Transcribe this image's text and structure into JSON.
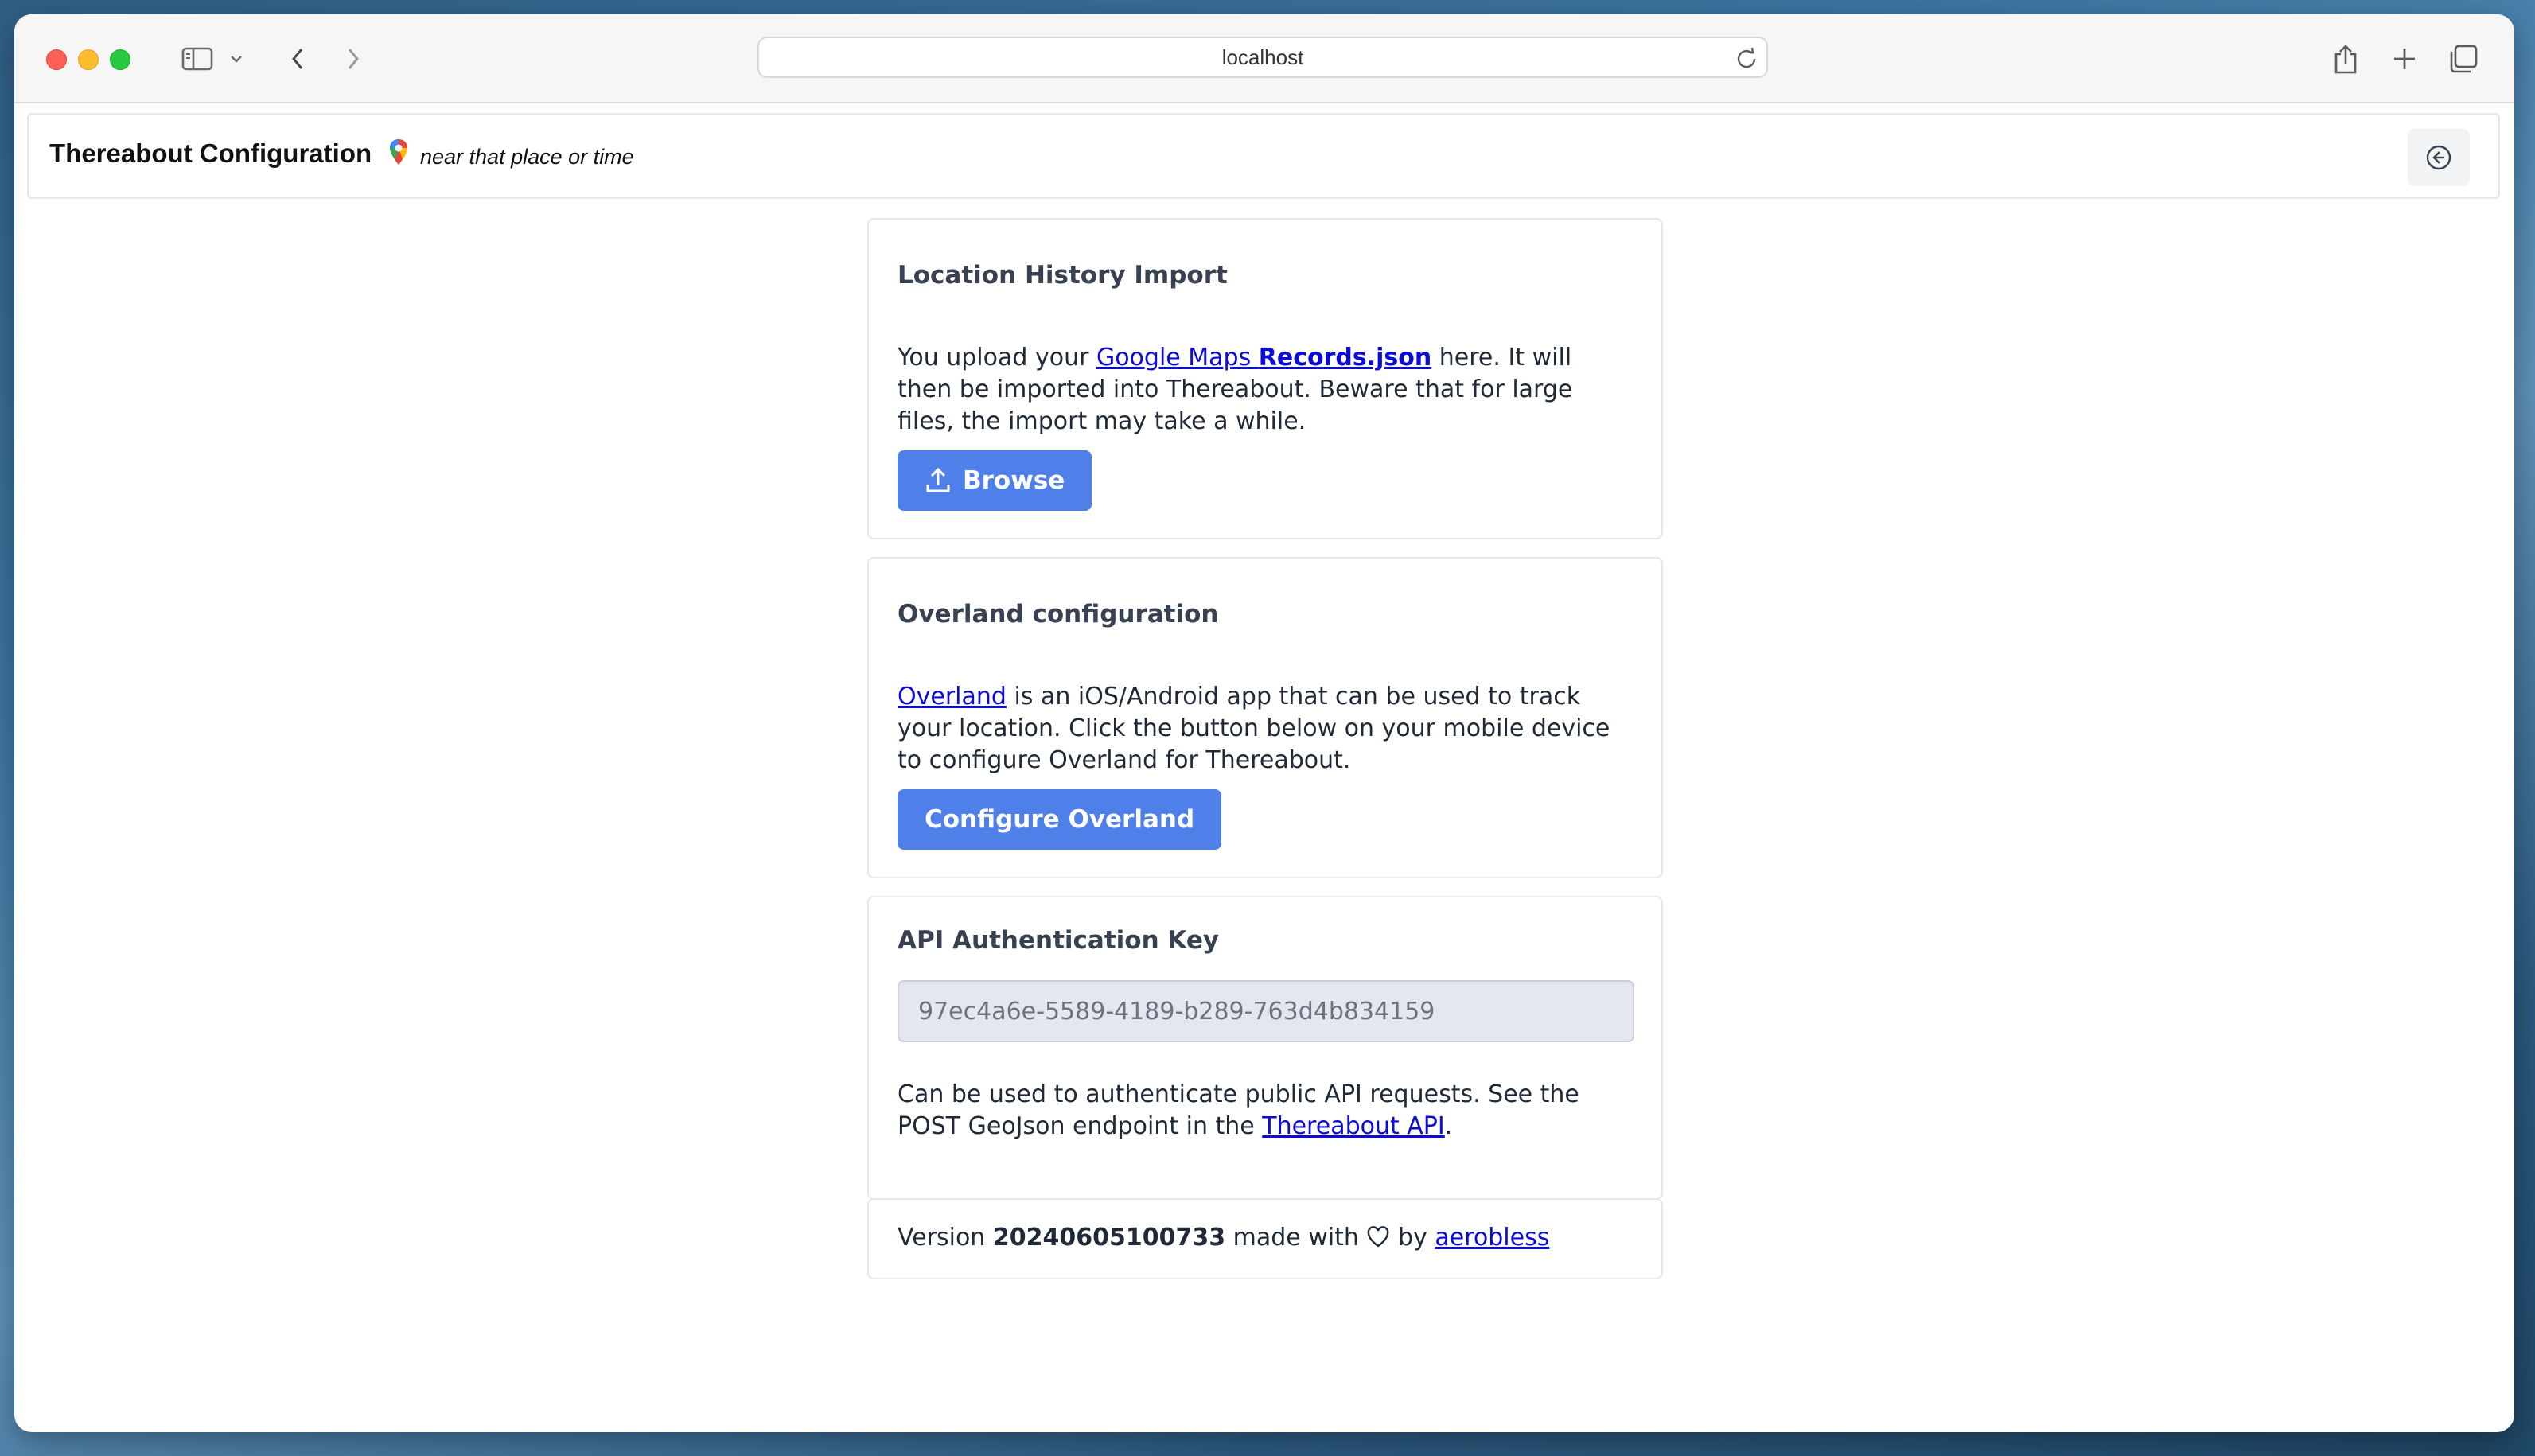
{
  "browser": {
    "url": "localhost"
  },
  "header": {
    "title": "Thereabout Configuration",
    "tagline": "near that place or time"
  },
  "location_import": {
    "heading": "Location History Import",
    "text_before": "You upload your ",
    "link_text": "Google Maps ",
    "link_bold": "Records.json",
    "text_after": " here. It will then be imported into Thereabout. Beware that for large files, the import may take a while.",
    "button_label": "Browse"
  },
  "overland": {
    "heading": "Overland configuration",
    "link_text": "Overland",
    "text_after": " is an iOS/Android app that can be used to track your location. Click the button below on your mobile device to configure Overland for Thereabout.",
    "button_label": "Configure Overland"
  },
  "api_key": {
    "heading": "API Authentication Key",
    "value": "97ec4a6e-5589-4189-b289-763d4b834159",
    "text_before": "Can be used to authenticate public API requests. See the POST GeoJson endpoint in the ",
    "link_text": "Thereabout API",
    "text_after": "."
  },
  "footer": {
    "version_label": "Version ",
    "version": "20240605100733",
    "made_with": " made with ",
    "by": " by ",
    "author": "aerobless"
  },
  "colors": {
    "primary_button": "#4f7fe8",
    "link": "#0b0bd8"
  }
}
